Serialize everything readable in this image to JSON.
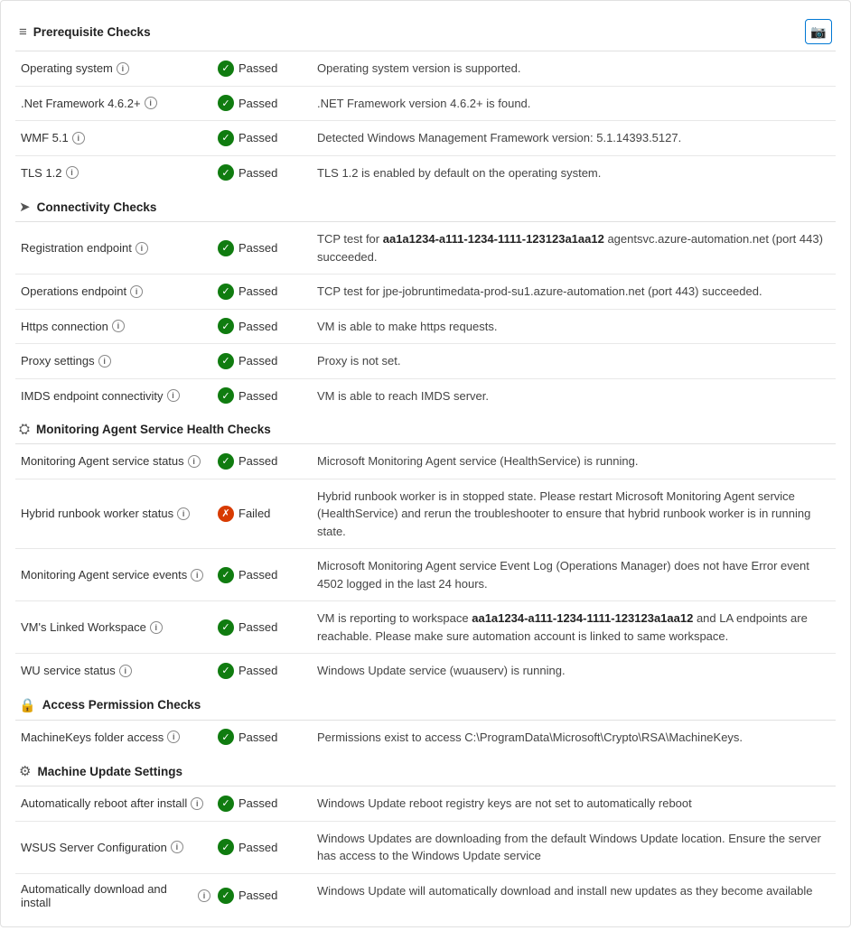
{
  "header": {
    "title": "Prerequisite Checks",
    "camera_icon": "📷"
  },
  "sections": [
    {
      "id": "prerequisite-checks",
      "title": "Prerequisite Checks",
      "icon": "≡",
      "icon_type": "list",
      "checks": [
        {
          "name": "Operating system",
          "has_info": true,
          "status": "Passed",
          "status_type": "passed",
          "description": "Operating system version is supported."
        },
        {
          "name": ".Net Framework 4.6.2+",
          "has_info": true,
          "status": "Passed",
          "status_type": "passed",
          "description": ".NET Framework version 4.6.2+ is found."
        },
        {
          "name": "WMF 5.1",
          "has_info": true,
          "status": "Passed",
          "status_type": "passed",
          "description": "Detected Windows Management Framework version: 5.1.14393.5127."
        },
        {
          "name": "TLS 1.2",
          "has_info": true,
          "status": "Passed",
          "status_type": "passed",
          "description": "TLS 1.2 is enabled by default on the operating system."
        }
      ]
    },
    {
      "id": "connectivity-checks",
      "title": "Connectivity Checks",
      "icon": "🔗",
      "icon_type": "connectivity",
      "checks": [
        {
          "name": "Registration endpoint",
          "has_info": true,
          "status": "Passed",
          "status_type": "passed",
          "description": "TCP test for aa1a1234-a111-1234-1111-123123a1aa12 agentsvc.azure-automation.net (port 443) succeeded.",
          "highlight": "aa1a1234-a111-1234-1111-123123a1aa12"
        },
        {
          "name": "Operations endpoint",
          "has_info": true,
          "status": "Passed",
          "status_type": "passed",
          "description": "TCP test for jpe-jobruntimedata-prod-su1.azure-automation.net (port 443) succeeded."
        },
        {
          "name": "Https connection",
          "has_info": true,
          "status": "Passed",
          "status_type": "passed",
          "description": "VM is able to make https requests."
        },
        {
          "name": "Proxy settings",
          "has_info": true,
          "status": "Passed",
          "status_type": "passed",
          "description": "Proxy is not set."
        },
        {
          "name": "IMDS endpoint connectivity",
          "has_info": true,
          "status": "Passed",
          "status_type": "passed",
          "description": "VM is able to reach IMDS server."
        }
      ]
    },
    {
      "id": "monitoring-agent-checks",
      "title": "Monitoring Agent Service Health Checks",
      "icon": "⚙",
      "icon_type": "monitoring",
      "checks": [
        {
          "name": "Monitoring Agent service status",
          "has_info": true,
          "status": "Passed",
          "status_type": "passed",
          "description": "Microsoft Monitoring Agent service (HealthService) is running."
        },
        {
          "name": "Hybrid runbook worker status",
          "has_info": true,
          "status": "Failed",
          "status_type": "failed",
          "description": "Hybrid runbook worker is in stopped state. Please restart Microsoft Monitoring Agent service (HealthService) and rerun the troubleshooter to ensure that hybrid runbook worker is in running state."
        },
        {
          "name": "Monitoring Agent service events",
          "has_info": true,
          "status": "Passed",
          "status_type": "passed",
          "description": "Microsoft Monitoring Agent service Event Log (Operations Manager) does not have Error event 4502 logged in the last 24 hours."
        },
        {
          "name": "VM's Linked Workspace",
          "has_info": true,
          "status": "Passed",
          "status_type": "passed",
          "description": "VM is reporting to workspace aa1a1234-a111-1234-1111-123123a1aa12 and LA endpoints are reachable. Please make sure automation account is linked to same workspace.",
          "highlight": "aa1a1234-a111-1234-1111-123123a1aa12"
        },
        {
          "name": "WU service status",
          "has_info": true,
          "status": "Passed",
          "status_type": "passed",
          "description": "Windows Update service (wuauserv) is running."
        }
      ]
    },
    {
      "id": "access-permission-checks",
      "title": "Access Permission Checks",
      "icon": "🔒",
      "icon_type": "lock",
      "checks": [
        {
          "name": "MachineKeys folder access",
          "has_info": true,
          "status": "Passed",
          "status_type": "passed",
          "description": "Permissions exist to access C:\\ProgramData\\Microsoft\\Crypto\\RSA\\MachineKeys."
        }
      ]
    },
    {
      "id": "machine-update-settings",
      "title": "Machine Update Settings",
      "icon": "⚙",
      "icon_type": "gear",
      "checks": [
        {
          "name": "Automatically reboot after install",
          "has_info": true,
          "status": "Passed",
          "status_type": "passed",
          "description": "Windows Update reboot registry keys are not set to automatically reboot"
        },
        {
          "name": "WSUS Server Configuration",
          "has_info": true,
          "status": "Passed",
          "status_type": "passed",
          "description": "Windows Updates are downloading from the default Windows Update location. Ensure the server has access to the Windows Update service"
        },
        {
          "name": "Automatically download and install",
          "has_info": true,
          "status": "Passed",
          "status_type": "passed",
          "description": "Windows Update will automatically download and install new updates as they become available"
        }
      ]
    }
  ]
}
